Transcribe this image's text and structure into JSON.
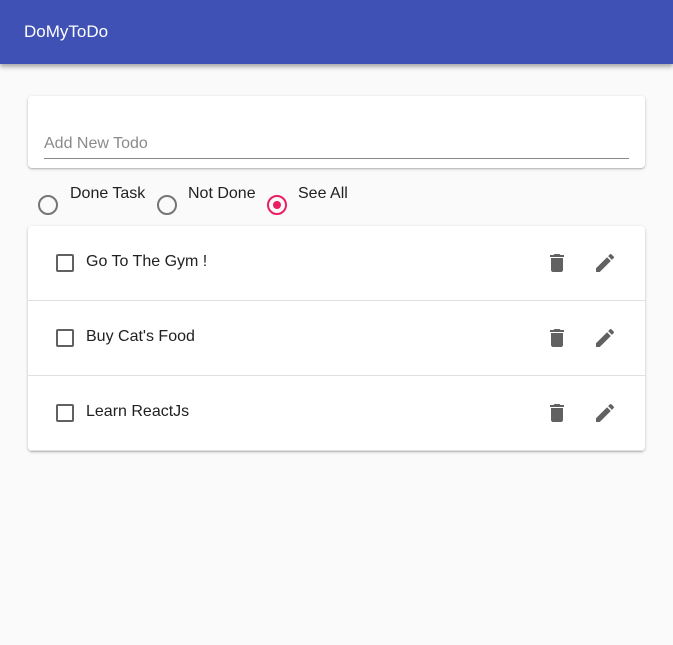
{
  "app": {
    "title": "DoMyToDo"
  },
  "add_todo": {
    "placeholder": "Add New Todo",
    "value": ""
  },
  "filters": {
    "options": [
      {
        "label": "Done Task",
        "selected": false
      },
      {
        "label": "Not Done",
        "selected": false
      },
      {
        "label": "See All",
        "selected": true
      }
    ]
  },
  "todos": [
    {
      "text": "Go To The Gym !",
      "done": false
    },
    {
      "text": "Buy Cat's Food",
      "done": false
    },
    {
      "text": "Learn ReactJs",
      "done": false
    }
  ],
  "icons": {
    "delete": "delete-icon",
    "edit": "edit-icon"
  },
  "colors": {
    "appbar": "#3f51b5",
    "radio_selected": "#e91e63",
    "background": "#fafafa"
  }
}
